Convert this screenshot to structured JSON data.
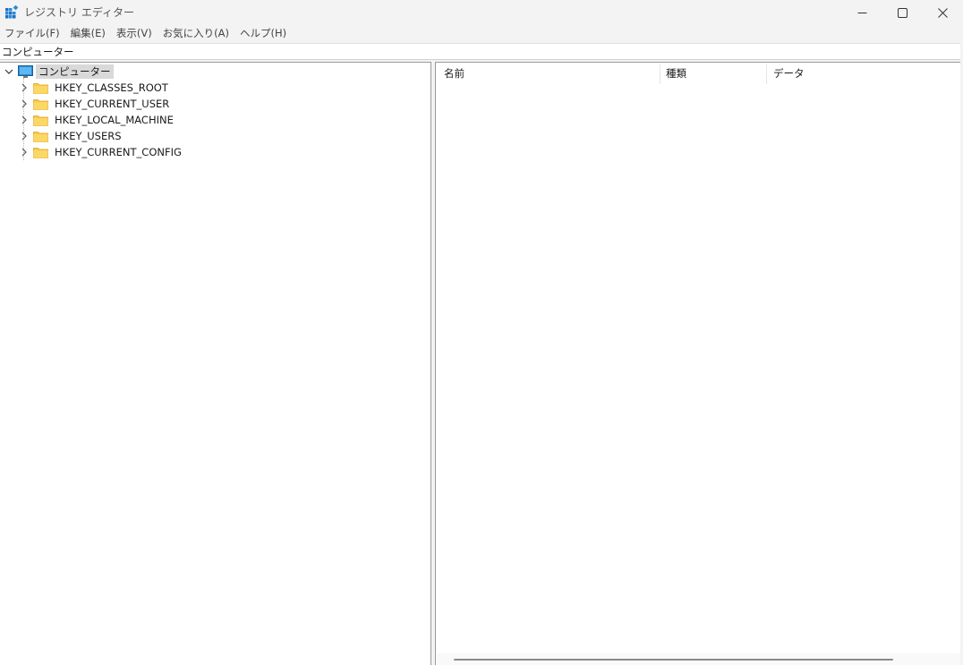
{
  "window": {
    "title": "レジストリ エディター"
  },
  "menu": {
    "items": [
      "ファイル(F)",
      "編集(E)",
      "表示(V)",
      "お気に入り(A)",
      "ヘルプ(H)"
    ]
  },
  "address": {
    "path": "コンピューター"
  },
  "tree": {
    "root_label": "コンピューター",
    "children": [
      "HKEY_CLASSES_ROOT",
      "HKEY_CURRENT_USER",
      "HKEY_LOCAL_MACHINE",
      "HKEY_USERS",
      "HKEY_CURRENT_CONFIG"
    ]
  },
  "list": {
    "columns": [
      "名前",
      "種類",
      "データ"
    ]
  },
  "icons": {
    "app": "registry-editor-icon",
    "minimize": "minimize-icon",
    "maximize": "maximize-icon",
    "close": "close-icon",
    "computer": "computer-icon",
    "folder": "folder-icon",
    "expanded": "chevron-down-icon",
    "collapsed": "chevron-right-icon"
  },
  "colors": {
    "folder": "#f8c94b",
    "computer": "#2b8cd6",
    "selection": "#d9d9d9"
  }
}
